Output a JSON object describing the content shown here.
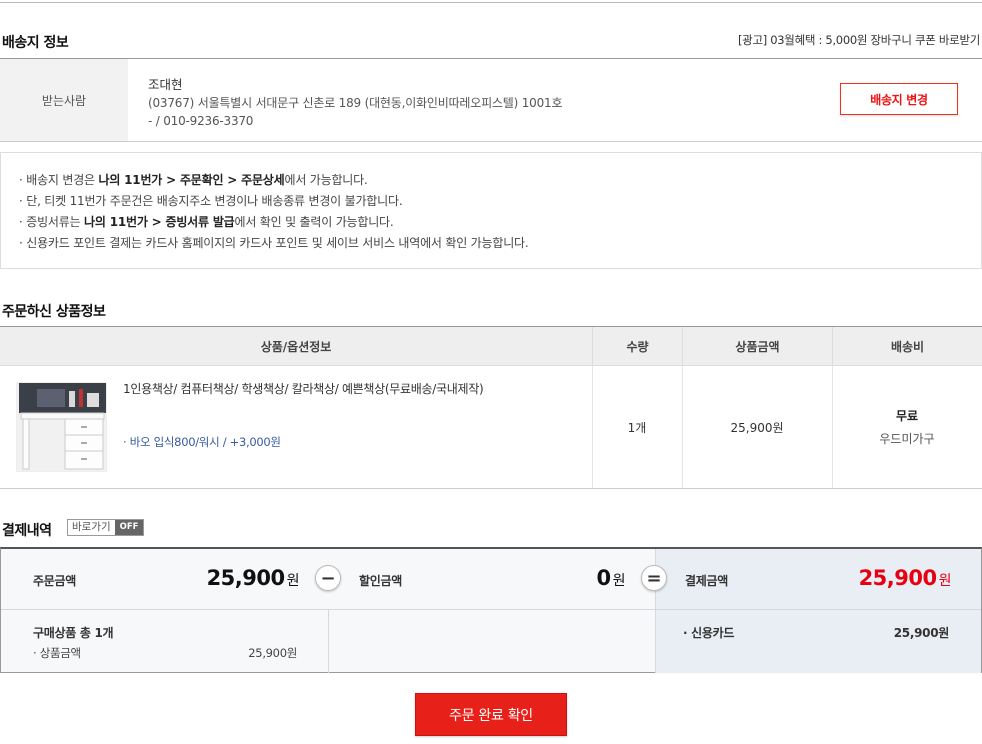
{
  "shipping": {
    "title": "배송지 정보",
    "ad": "[광고] 03월혜택 : 5,000원 장바구니 쿠폰 바로받기",
    "recipient_label": "받는사람",
    "name": "조대현",
    "address": "(03767) 서울특별시 서대문구 신촌로 189 (대현동,이화인비따레오피스텔) 1001호",
    "phone": "- / 010-9236-3370",
    "change_button": "배송지 변경"
  },
  "notices": {
    "n1_pre": "· 배송지 변경은 ",
    "n1_bold": "나의 11번가 > 주문확인 > 주문상세",
    "n1_post": "에서 가능합니다.",
    "n2": "· 단, 티켓 11번가 주문건은 배송지주소 변경이나 배송종류 변경이 불가합니다.",
    "n3_pre": "· 증빙서류는 ",
    "n3_bold": "나의 11번가 > 증빙서류 발급",
    "n3_post": "에서 확인 및 출력이 가능합니다.",
    "n4": "· 신용카드 포인트 결제는 카드사 홈페이지의 카드사 포인트 및 세이브 서비스 내역에서 확인 가능합니다."
  },
  "products": {
    "title": "주문하신 상품정보",
    "headers": [
      "상품/옵션정보",
      "수량",
      "상품금액",
      "배송비"
    ],
    "item": {
      "name": "1인용책상/ 컴퓨터책상/ 학생책상/ 칼라책상/ 예쁜책상(무료배송/국내제작)",
      "option": "· 바오 입식800/워시 / +3,000원",
      "qty": "1개",
      "price": "25,900원",
      "shipping": "무료",
      "seller": "우드미가구"
    }
  },
  "payment": {
    "title": "결제내역",
    "toggle_label": "바로가기",
    "toggle_state": "OFF",
    "order_label": "주문금액",
    "order_amount": "25,900",
    "discount_label": "할인금액",
    "discount_amount": "0",
    "total_label": "결제금액",
    "total_amount": "25,900",
    "won": "원",
    "count_label": "구매상품 총 1개",
    "sub_label": "· 상품금액",
    "sub_amount": "25,900원",
    "method_label": "· 신용카드",
    "method_amount": "25,900원",
    "accent_color": "#e60012"
  },
  "confirm_button": "주문 완료 확인"
}
